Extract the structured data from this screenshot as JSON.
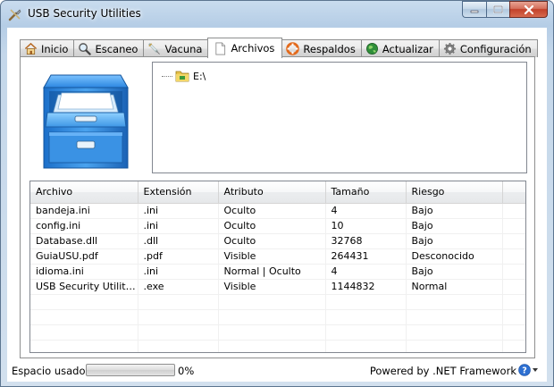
{
  "window": {
    "title": "USB Security Utilities"
  },
  "tabs": [
    {
      "label": "Inicio",
      "icon": "home-icon"
    },
    {
      "label": "Escaneo",
      "icon": "magnifier-icon"
    },
    {
      "label": "Vacuna",
      "icon": "syringe-icon"
    },
    {
      "label": "Archivos",
      "icon": "document-icon",
      "active": true
    },
    {
      "label": "Respaldos",
      "icon": "lifebuoy-icon"
    },
    {
      "label": "Actualizar",
      "icon": "globe-icon"
    },
    {
      "label": "Configuración",
      "icon": "gear-icon"
    }
  ],
  "tree": {
    "root": "E:\\"
  },
  "table": {
    "columns": [
      "Archivo",
      "Extensión",
      "Atributo",
      "Tamaño",
      "Riesgo"
    ],
    "rows": [
      [
        "bandeja.ini",
        ".ini",
        "Oculto",
        "4",
        "Bajo"
      ],
      [
        "config.ini",
        ".ini",
        "Oculto",
        "10",
        "Bajo"
      ],
      [
        "Database.dll",
        ".dll",
        "Oculto",
        "32768",
        "Bajo"
      ],
      [
        "GuiaUSU.pdf",
        ".pdf",
        "Visible",
        "264431",
        "Desconocido"
      ],
      [
        "idioma.ini",
        ".ini",
        "Normal | Oculto",
        "4",
        "Bajo"
      ],
      [
        "USB Security Utilitie...",
        ".exe",
        "Visible",
        "1144832",
        "Normal"
      ]
    ]
  },
  "status": {
    "label": "Espacio usado:",
    "progress_percent": 0,
    "progress_text": "0%",
    "powered": "Powered by .NET Framework"
  },
  "colors": {
    "accent": "#3a7fd6",
    "progress": "#37b337",
    "close": "#c2412a"
  }
}
